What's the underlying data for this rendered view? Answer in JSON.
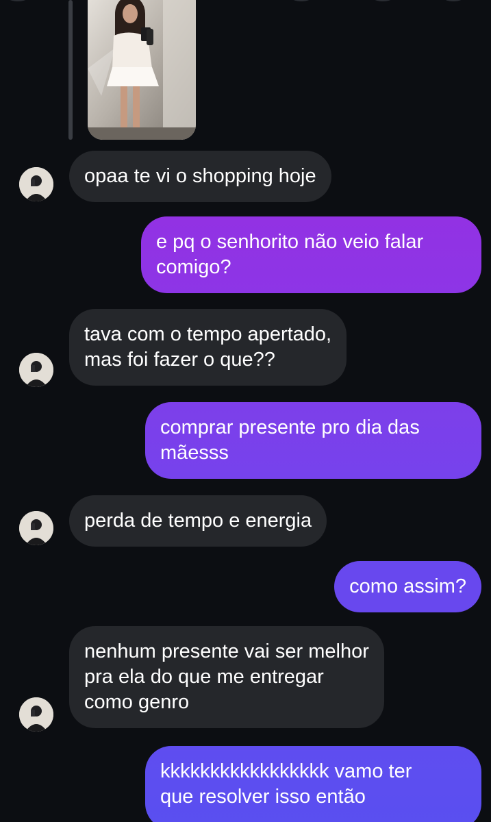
{
  "colors": {
    "background": "#0c0e12",
    "incoming_bubble": "#25272b",
    "outgoing_gradient_top": "#9232e3",
    "outgoing_gradient_bottom": "#5b4ef0",
    "text": "#ffffff"
  },
  "header": {
    "icons": [
      "back-icon",
      "call-icon",
      "video-icon",
      "info-icon"
    ]
  },
  "shared_photo": {
    "description_icon": "photo-thumbnail"
  },
  "messages": [
    {
      "side": "in",
      "text": "opaa te vi o shopping hoje"
    },
    {
      "side": "out",
      "text": "e pq o senhorito não veio falar\ncomigo?"
    },
    {
      "side": "in",
      "text": "tava com o tempo apertado,\nmas foi fazer o que??"
    },
    {
      "side": "out",
      "text": "comprar presente pro dia das\nmãesss"
    },
    {
      "side": "in",
      "text": "perda de tempo e energia"
    },
    {
      "side": "out",
      "text": "como assim?"
    },
    {
      "side": "in",
      "text": "nenhum presente vai ser melhor\npra ela do que me entregar\ncomo genro"
    },
    {
      "side": "out",
      "text": "kkkkkkkkkkkkkkkkk vamo ter\nque resolver isso então"
    }
  ]
}
